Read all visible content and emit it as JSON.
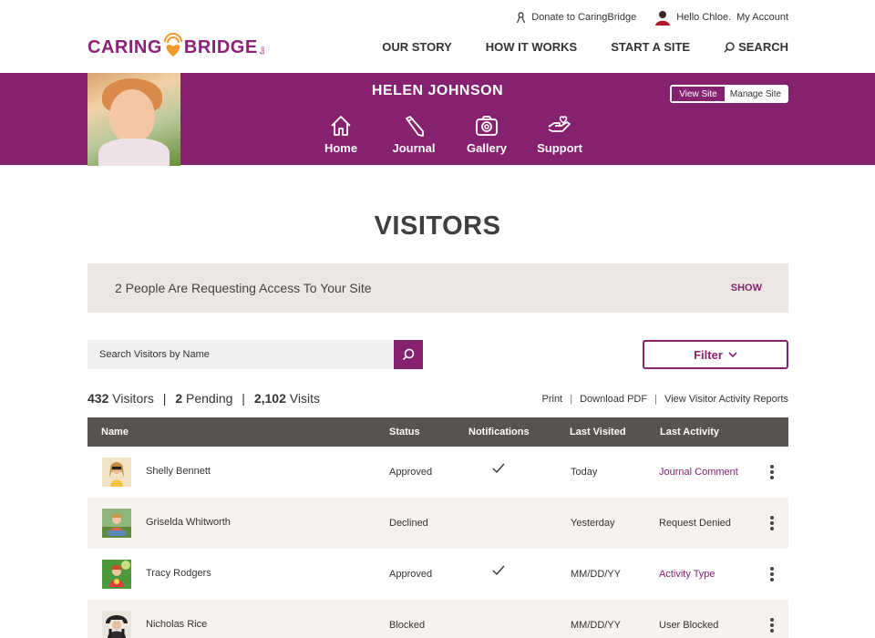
{
  "utility": {
    "donate": "Donate to CaringBridge",
    "hello": "Hello Chloe.",
    "account": "My Account"
  },
  "logo": {
    "part1": "CARING",
    "part2": "BRIDGE",
    "suffix": "org"
  },
  "nav": {
    "story": "OUR STORY",
    "how": "HOW IT WORKS",
    "start": "START A SITE",
    "search": "SEARCH"
  },
  "site": {
    "name": "HELEN JOHNSON",
    "tabs": [
      "Home",
      "Journal",
      "Gallery",
      "Support"
    ],
    "view_site": "View Site",
    "manage_site": "Manage Site"
  },
  "page": {
    "title": "VISITORS"
  },
  "request": {
    "text": "2 People Are Requesting Access To Your Site",
    "action": "SHOW"
  },
  "search": {
    "placeholder": "Search Visitors by Name"
  },
  "filter": {
    "label": "Filter"
  },
  "summary": {
    "visitors_count": "432",
    "visitors_label": "Visitors",
    "pending_count": "2",
    "pending_label": "Pending",
    "visits_count": "2,102",
    "visits_label": "Visits",
    "sep": "|"
  },
  "links": {
    "print": "Print",
    "download": "Download PDF",
    "reports": "View Visitor Activity Reports",
    "sep": "|"
  },
  "table": {
    "headers": {
      "name": "Name",
      "status": "Status",
      "notifications": "Notifications",
      "last_visited": "Last Visited",
      "last_activity": "Last Activity"
    },
    "rows": [
      {
        "name": "Shelly Bennett",
        "status": "Approved",
        "notify": true,
        "last_visited": "Today",
        "last_activity": "Journal Comment",
        "activity_link": true
      },
      {
        "name": "Griselda Whitworth",
        "status": "Declined",
        "notify": false,
        "last_visited": "Yesterday",
        "last_activity": "Request Denied",
        "activity_link": false
      },
      {
        "name": "Tracy Rodgers",
        "status": "Approved",
        "notify": true,
        "last_visited": "MM/DD/YY",
        "last_activity": "Activity Type",
        "activity_link": true
      },
      {
        "name": "Nicholas Rice",
        "status": "Blocked",
        "notify": false,
        "last_visited": "MM/DD/YY",
        "last_activity": "User Blocked",
        "activity_link": false
      }
    ]
  },
  "colors": {
    "brand": "#86216f",
    "header_bg": "#585251",
    "row_alt": "#f5f2f0",
    "request_bg": "#ece6e4",
    "logo_heart": "#f39a2c"
  }
}
